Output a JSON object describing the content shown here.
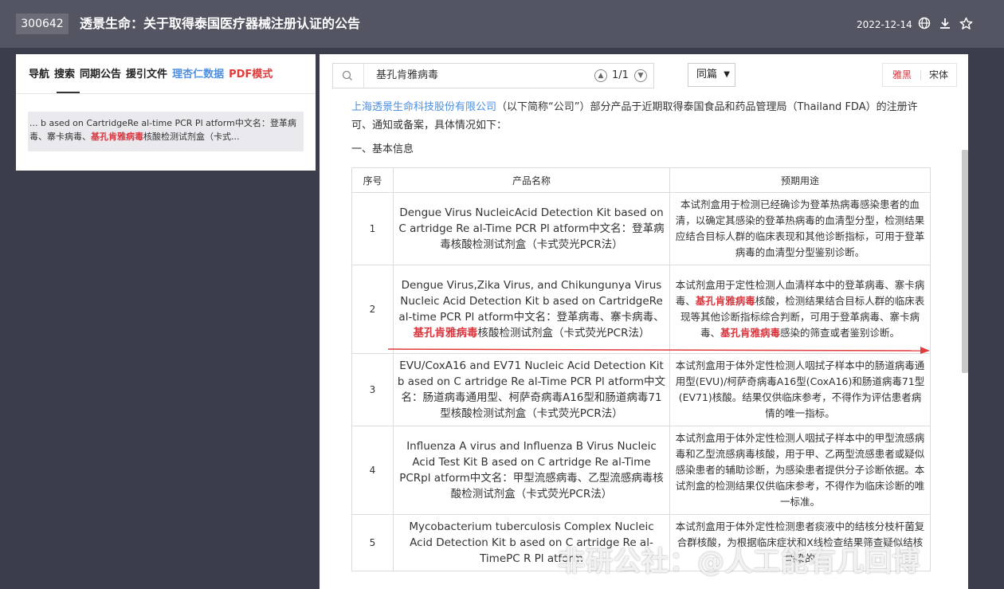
{
  "header": {
    "code": "300642",
    "title": "透景生命：关于取得泰国医疗器械注册认证的公告",
    "date": "2022-12-14",
    "icons": [
      "globe-icon",
      "download-icon",
      "star-icon"
    ]
  },
  "sidebar": {
    "tabs": [
      {
        "label": "导航"
      },
      {
        "label": "搜索"
      },
      {
        "label": "同期公告"
      },
      {
        "label": "援引文件"
      },
      {
        "label": "理杏仁数据"
      },
      {
        "label": "PDF模式"
      }
    ],
    "result": {
      "before": "... b ased on CartridgeRe al-time PCR Pl atform中文名：登革病毒、寨卡病毒、",
      "highlight": "基孔肯雅病毒",
      "after": "核酸检测试剂盒（卡式..."
    }
  },
  "toolbar": {
    "search_value": "基孔肯雅病毒",
    "counter": "1/1",
    "scope_select": "同篇",
    "font_options": [
      "雅黑",
      "宋体"
    ]
  },
  "document": {
    "company_link": "上海透景生命科技股份有限公司",
    "intro_rest": "（以下简称“公司”）部分产品于近期取得泰国食品和药品管理局（Thailand FDA）的注册许可、通知或备案，具体情况如下：",
    "section_title": "一、基本信息",
    "table": {
      "headers": [
        "序号",
        "产品名称",
        "预期用途"
      ],
      "rows": [
        {
          "num": "1",
          "name": "Dengue Virus NucleicAcid Detection Kit based on C artridge Re al-Time PCR Pl atform中文名：登革病毒核酸检测试剂盒（卡式荧光PCR法）",
          "use": "本试剂盒用于检测已经确诊为登革热病毒感染患者的血清，以确定其感染的登革热病毒的血清型分型，检测结果应结合目标人群的临床表现和其他诊断指标，可用于登革病毒的血清型分型鉴别诊断。"
        },
        {
          "num": "2",
          "name_before": "Dengue Virus,Zika Virus, and Chikungunya Virus Nucleic Acid Detection Kit b ased on CartridgeRe al-time PCR Pl atform中文名：登革病毒、寨卡病毒、",
          "name_hl": "基孔肯雅病毒",
          "name_after": "核酸检测试剂盒（卡式荧光PCR法）",
          "use_a": "本试剂盒用于定性检测人血清样本中的登革病毒、寨卡病毒、",
          "use_hl1": "基孔肯雅病毒",
          "use_b": "核酸，检测结果结合目标人群的临床表现等其他诊断指标综合判断，可用于登革病毒、寨卡病毒、",
          "use_hl2": "基孔肯雅病毒",
          "use_c": "感染的筛查或者鉴别诊断。"
        },
        {
          "num": "3",
          "name": "EVU/CoxA16 and EV71 Nucleic Acid Detection Kit b ased on C artridge Re al-Time PCR Pl atform中文名：肠道病毒通用型、柯萨奇病毒A16型和肠道病毒71型核酸检测试剂盒（卡式荧光PCR法）",
          "use": "本试剂盒用于体外定性检测人咽拭子样本中的肠道病毒通用型(EVU)/柯萨奇病毒A16型(CoxA16)和肠道病毒71型(EV71)核酸。结果仅供临床参考，不得作为评估患者病情的唯一指标。"
        },
        {
          "num": "4",
          "name": "Influenza A virus and Influenza B Virus Nucleic Acid Test Kit B ased on C artridge Re al-Time PCRpl atform中文名：甲型流感病毒、乙型流感病毒核酸检测试剂盒（卡式荧光PCR法）",
          "use": "本试剂盒用于体外定性检测人咽拭子样本中的甲型流感病毒和乙型流感病毒核酸，用于甲、乙两型流感患者或疑似感染患者的辅助诊断，为感染患者提供分子诊断依据。本试剂盒的检测结果仅供临床参考，不得作为临床诊断的唯一标准。"
        },
        {
          "num": "5",
          "name": "Mycobacterium tuberculosis Complex Nucleic Acid Detection Kit b ased on C artridge Re al-TimePC R Pl atform",
          "use": "本试剂盒用于体外定性检测患者痰液中的结核分枝杆菌复合群核酸，为根据临床症状和X线检查结果筛查疑似结核感染的"
        }
      ]
    }
  },
  "watermark": "非研公社：@人工能有几回博",
  "colors": {
    "accent_blue": "#4d8fe0",
    "highlight_red": "#d9363e",
    "topbar": "#545563",
    "background": "#3c3d4a"
  }
}
